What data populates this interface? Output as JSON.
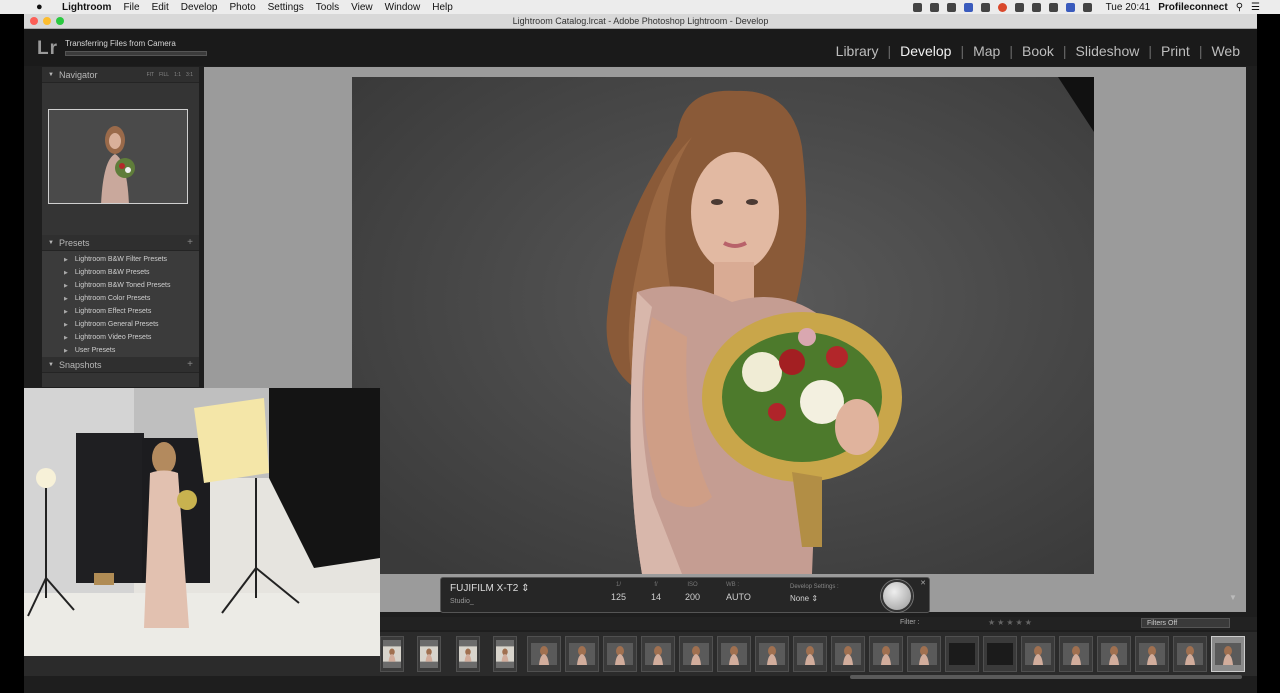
{
  "menubar": {
    "app_name": "Lightroom",
    "items": [
      "File",
      "Edit",
      "Develop",
      "Photo",
      "Settings",
      "Tools",
      "View",
      "Window",
      "Help"
    ],
    "clock": "Tue 20:41",
    "user": "Profileconnect"
  },
  "window": {
    "title": "Lightroom Catalog.lrcat - Adobe Photoshop Lightroom - Develop"
  },
  "identity_plate": {
    "logo": "Lr",
    "status": "Transferring Files from Camera",
    "progress": 0.0
  },
  "modules": [
    "Library",
    "Develop",
    "Map",
    "Book",
    "Slideshow",
    "Print",
    "Web"
  ],
  "active_module": "Develop",
  "navigator": {
    "title": "Navigator",
    "zoom_options": [
      "FIT",
      "FILL",
      "1:1",
      "3:1"
    ]
  },
  "presets": {
    "title": "Presets",
    "items": [
      "Lightroom B&W Filter Presets",
      "Lightroom B&W Presets",
      "Lightroom B&W Toned Presets",
      "Lightroom Color Presets",
      "Lightroom Effect Presets",
      "Lightroom General Presets",
      "Lightroom Video Presets",
      "User Presets"
    ]
  },
  "snapshots": {
    "title": "Snapshots"
  },
  "info_overlay": {
    "camera": "FUJIFILM X-T2",
    "camera_sub": "Studio_",
    "shutter_label": "1/",
    "shutter": "125",
    "aperture_label": "f/",
    "aperture": "14",
    "iso_label": "ISO",
    "iso": "200",
    "wb_label": "WB :",
    "wb": "AUTO",
    "develop_label": "Develop Settings :",
    "develop": "None"
  },
  "filterbar": {
    "label": "Filter :",
    "filter_value": "Filters Off"
  },
  "colors": {
    "lr_bg": "#1e1e1e",
    "panel": "#343434",
    "main_bg": "#9b9b9b",
    "accent_text": "#f2f2f2"
  }
}
